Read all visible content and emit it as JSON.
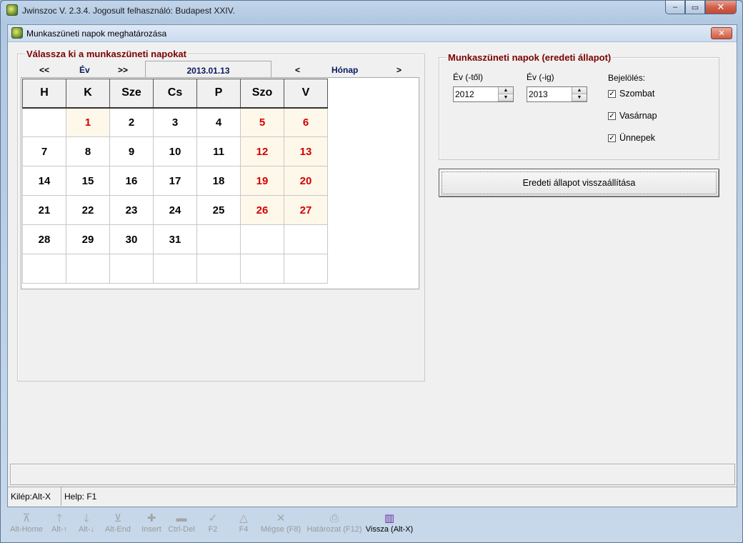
{
  "window": {
    "title": "Jwinszoc V. 2.3.4.  Jogosult felhasználó: Budapest XXIV.",
    "minimize": "–",
    "restore": "▭",
    "close": "✕"
  },
  "dialog": {
    "title": "Munkaszüneti napok meghatározása",
    "close": "✕"
  },
  "calendar_group": {
    "legend": "Válassza ki a munkaszüneti napokat",
    "nav": {
      "prev_year": "<<",
      "year_label": "Év",
      "next_year": ">>",
      "current_date": "2013.01.13",
      "prev_month": "<",
      "month_label": "Hónap",
      "next_month": ">"
    },
    "weekdays": [
      "H",
      "K",
      "Sze",
      "Cs",
      "P",
      "Szo",
      "V"
    ],
    "weeks": [
      [
        "",
        "1",
        "2",
        "3",
        "4",
        "5",
        "6"
      ],
      [
        "7",
        "8",
        "9",
        "10",
        "11",
        "12",
        "13"
      ],
      [
        "14",
        "15",
        "16",
        "17",
        "18",
        "19",
        "20"
      ],
      [
        "21",
        "22",
        "23",
        "24",
        "25",
        "26",
        "27"
      ],
      [
        "28",
        "29",
        "30",
        "31",
        "",
        "",
        ""
      ],
      [
        "",
        "",
        "",
        "",
        "",
        "",
        ""
      ]
    ],
    "holidays": [
      "1",
      "5",
      "6",
      "12",
      "13",
      "19",
      "20",
      "26",
      "27"
    ],
    "holiday_color": "#d40000"
  },
  "original_group": {
    "legend": "Munkaszüneti napok (eredeti állapot)",
    "year_from_label": "Év (-től)",
    "year_from_value": "2012",
    "year_to_label": "Év (-ig)",
    "year_to_value": "2013",
    "marking_label": "Bejelölés:",
    "checkboxes": [
      {
        "label": "Szombat",
        "checked": true
      },
      {
        "label": "Vasárnap",
        "checked": true
      },
      {
        "label": "Ünnepek",
        "checked": true
      }
    ],
    "reset_button": "Eredeti állapot visszaállítása"
  },
  "status": {
    "exit": "Kilép:Alt-X",
    "help": "Help: F1"
  },
  "toolbar": [
    {
      "icon": "first-record-icon",
      "glyph": "⊼",
      "label": "Alt-Home",
      "enabled": false
    },
    {
      "icon": "prev-record-icon",
      "glyph": "🡑",
      "label": "Alt-↑",
      "enabled": false
    },
    {
      "icon": "next-record-icon",
      "glyph": "🡓",
      "label": "Alt-↓",
      "enabled": false
    },
    {
      "icon": "last-record-icon",
      "glyph": "⊻",
      "label": "Alt-End",
      "enabled": false
    },
    {
      "icon": "insert-icon",
      "glyph": "✚",
      "label": "Insert",
      "enabled": false
    },
    {
      "icon": "delete-icon",
      "glyph": "▬",
      "label": "Ctrl-Del",
      "enabled": false
    },
    {
      "icon": "save-check-icon",
      "glyph": "✓",
      "label": "F2",
      "enabled": false
    },
    {
      "icon": "edit-triangle-icon",
      "glyph": "△",
      "label": "F4",
      "enabled": false
    },
    {
      "icon": "cancel-icon",
      "glyph": "✕",
      "label": "Mégse (F8)",
      "enabled": false
    },
    {
      "icon": "printer-icon",
      "glyph": "⎙",
      "label": "Határozat (F12)",
      "enabled": false
    },
    {
      "icon": "exit-door-icon",
      "glyph": "▥",
      "label": "Vissza (Alt-X)",
      "enabled": true
    }
  ]
}
